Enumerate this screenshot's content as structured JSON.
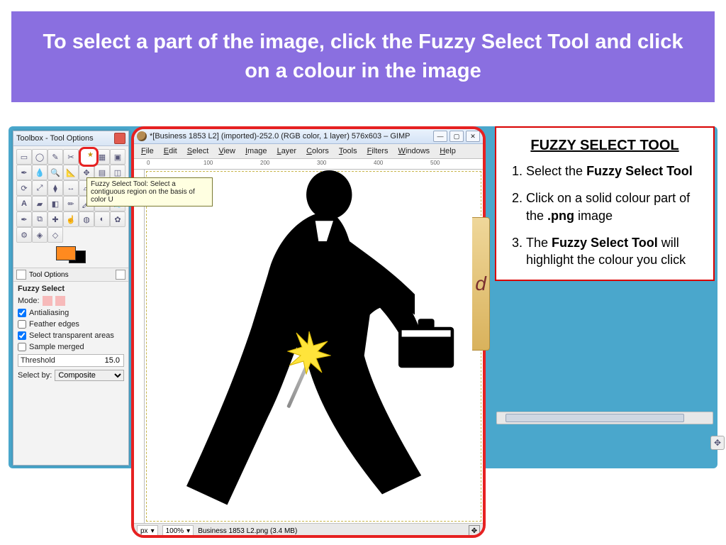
{
  "banner": {
    "text": "To select a part of the image, click the Fuzzy Select Tool and click on a colour in the image"
  },
  "toolbox": {
    "title": "Toolbox - Tool Options",
    "tooltip": "Fuzzy Select Tool: Select a contiguous region on the basis of color  U",
    "tool_options_header": "Tool Options",
    "tool_name": "Fuzzy Select",
    "mode_label": "Mode:",
    "antialias": "Antialiasing",
    "feather": "Feather edges",
    "transparent": "Select transparent areas",
    "sample_merged": "Sample merged",
    "threshold_label": "Threshold",
    "threshold_value": "15.0",
    "selectby_label": "Select by:",
    "selectby_value": "Composite",
    "fg_color": "#ff8a1f",
    "bg_color": "#000000"
  },
  "gimp": {
    "window_title": "*[Business 1853 L2] (imported)-252.0 (RGB color, 1 layer) 576x603 – GIMP",
    "menus": [
      "File",
      "Edit",
      "Select",
      "View",
      "Image",
      "Layer",
      "Colors",
      "Tools",
      "Filters",
      "Windows",
      "Help"
    ],
    "ruler_marks": [
      "0",
      "100",
      "200",
      "300",
      "400",
      "500"
    ],
    "status": {
      "unit": "px",
      "zoom": "100%",
      "file": "Business 1853 L2.png (3.4 MB)"
    },
    "side_letter": "d"
  },
  "instructions": {
    "title": "FUZZY SELECT TOOL",
    "steps": [
      {
        "pre": "Select the ",
        "b": "Fuzzy Select Tool",
        "post": ""
      },
      {
        "pre": "Click on a solid colour part of the ",
        "b": ".png",
        "post": " image"
      },
      {
        "pre": "The ",
        "b": "Fuzzy Select Tool",
        "post": " will highlight the colour you click"
      }
    ]
  }
}
